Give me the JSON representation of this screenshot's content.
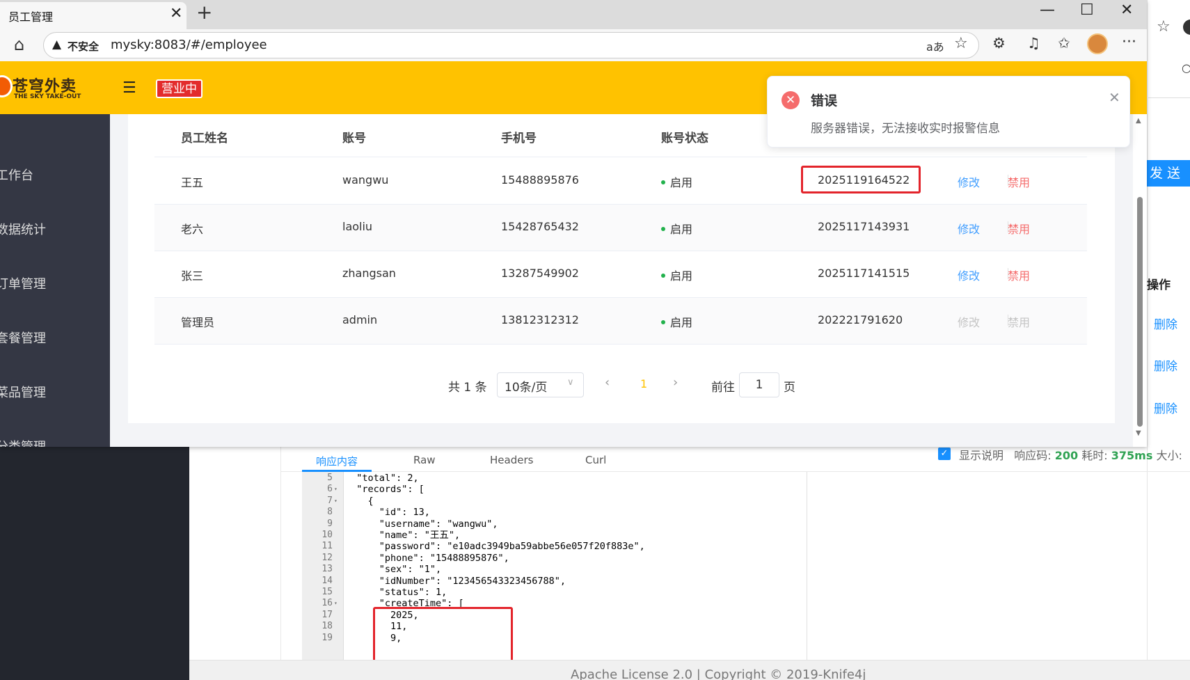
{
  "browser": {
    "tab_title": "员工管理",
    "tab_close": "✕",
    "new_tab": "+",
    "win_minimize": "—",
    "win_maximize": "☐",
    "win_close": "✕",
    "security_label": "不安全",
    "url": "mysky:8083/#/employee",
    "read_aloud": "aあ",
    "icons": [
      "home-icon",
      "warning-icon",
      "read-aloud-icon",
      "favorite-star-icon",
      "extensions-icon",
      "music-icon",
      "favorites-icon",
      "avatar-icon",
      "more-icon"
    ]
  },
  "app": {
    "logo_cn": "苍穹外卖",
    "logo_en": "THE SKY TAKE-OUT",
    "status_tag": "营业中",
    "sidebar": [
      {
        "label": "工作台"
      },
      {
        "label": "数据统计"
      },
      {
        "label": "订单管理"
      },
      {
        "label": "套餐管理"
      },
      {
        "label": "菜品管理"
      },
      {
        "label": "分类管理"
      }
    ],
    "table": {
      "headers": [
        "员工姓名",
        "账号",
        "手机号",
        "账号状态"
      ],
      "rows": [
        {
          "name": "王五",
          "account": "wangwu",
          "phone": "15488895876",
          "status": "启用",
          "time": "2025119164522",
          "edit": "修改",
          "ban": "禁用"
        },
        {
          "name": "老六",
          "account": "laoliu",
          "phone": "15428765432",
          "status": "启用",
          "time": "2025117143931",
          "edit": "修改",
          "ban": "禁用"
        },
        {
          "name": "张三",
          "account": "zhangsan",
          "phone": "13287549902",
          "status": "启用",
          "time": "2025117141515",
          "edit": "修改",
          "ban": "禁用"
        },
        {
          "name": "管理员",
          "account": "admin",
          "phone": "13812312312",
          "status": "启用",
          "time": "202221791620",
          "edit": "修改",
          "ban": "禁用"
        }
      ]
    },
    "pagination": {
      "total": "共 1 条",
      "page_size": "10条/页",
      "prev": "‹",
      "current": "1",
      "next": "›",
      "goto_label": "前往",
      "goto_value": "1",
      "goto_unit": "页"
    },
    "notification": {
      "title": "错误",
      "message": "服务器错误，无法接收实时报警信息",
      "close": "✕"
    }
  },
  "background": {
    "send_button": "发 送",
    "op_header": "操作",
    "delete_label": "删除",
    "tabs": [
      "响应内容",
      "Raw",
      "Headers",
      "Curl"
    ],
    "show_desc": "显示说明",
    "resp_code_label": "响应码:",
    "resp_code": "200",
    "time_label": "耗时:",
    "time_value": "375ms",
    "size_label": "大小:",
    "footer": "Apache License 2.0 | Copyright © 2019-Knife4j",
    "code_lines": [
      {
        "n": "5",
        "fold": "",
        "text": "  \"total\": 2,"
      },
      {
        "n": "6",
        "fold": "▾",
        "text": "  \"records\": ["
      },
      {
        "n": "7",
        "fold": "▾",
        "text": "    {"
      },
      {
        "n": "8",
        "fold": "",
        "text": "      \"id\": 13,"
      },
      {
        "n": "9",
        "fold": "",
        "text": "      \"username\": \"wangwu\","
      },
      {
        "n": "10",
        "fold": "",
        "text": "      \"name\": \"王五\","
      },
      {
        "n": "11",
        "fold": "",
        "text": "      \"password\": \"e10adc3949ba59abbe56e057f20f883e\","
      },
      {
        "n": "12",
        "fold": "",
        "text": "      \"phone\": \"15488895876\","
      },
      {
        "n": "13",
        "fold": "",
        "text": "      \"sex\": \"1\","
      },
      {
        "n": "14",
        "fold": "",
        "text": "      \"idNumber\": \"123456543323456788\","
      },
      {
        "n": "15",
        "fold": "",
        "text": "      \"status\": 1,"
      },
      {
        "n": "16",
        "fold": "▾",
        "text": "      \"createTime\": ["
      },
      {
        "n": "17",
        "fold": "",
        "text": "        2025,"
      },
      {
        "n": "18",
        "fold": "",
        "text": "        11,"
      },
      {
        "n": "19",
        "fold": "",
        "text": "        9,"
      }
    ]
  }
}
